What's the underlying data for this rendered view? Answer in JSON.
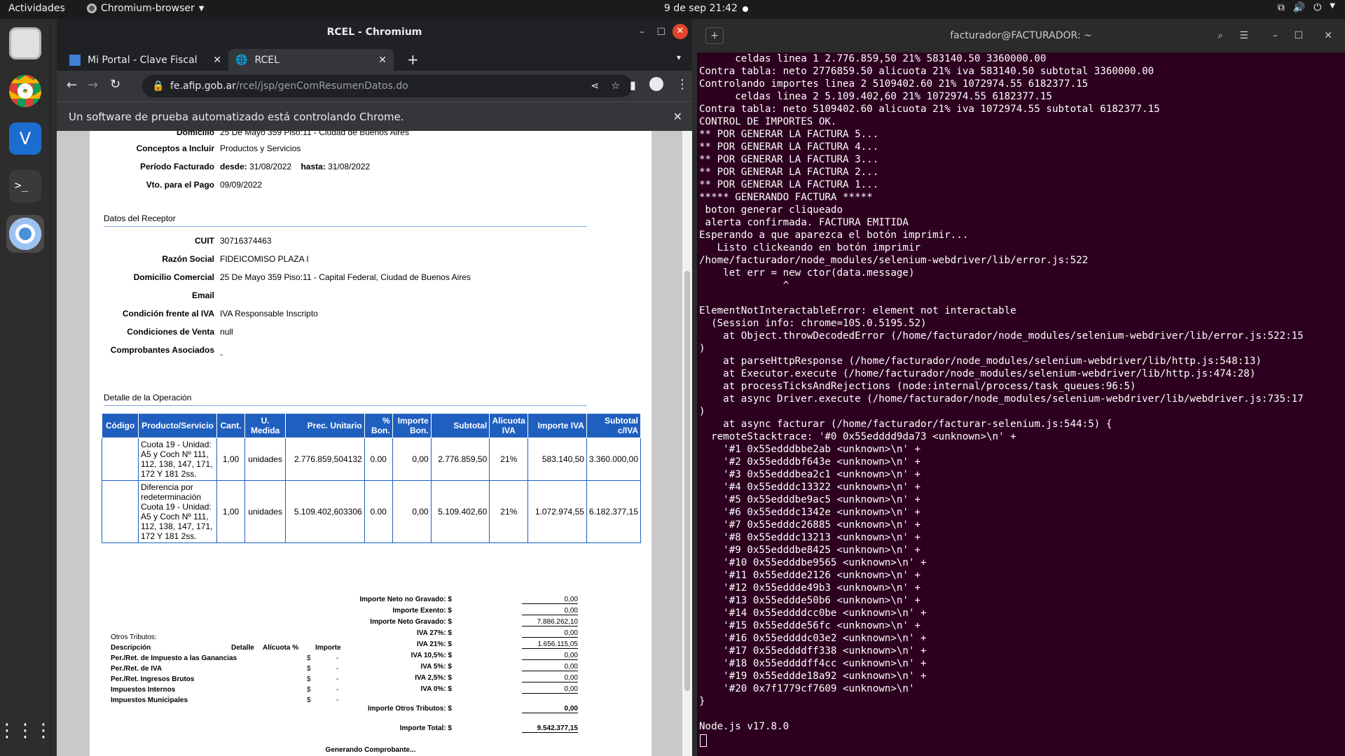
{
  "topbar": {
    "activities": "Actividades",
    "app": "Chromium-browser",
    "clock": "9 de sep  21:42"
  },
  "browser": {
    "window_title": "RCEL - Chromium",
    "tabs": [
      {
        "label": "Mi Portal - Clave Fiscal"
      },
      {
        "label": "RCEL"
      }
    ],
    "url_host": "fe.afip.gob.ar",
    "url_path": "/rcel/jsp/genComResumenDatos.do",
    "infobar": "Un software de prueba automatizado está controlando Chrome."
  },
  "invoice": {
    "top_rows": [
      {
        "label": "Domicilio",
        "value": "25 De Mayo 359 Piso:11 - Ciudad de Buenos Aires"
      },
      {
        "label": "Conceptos a Incluir",
        "value": "Productos y Servicios"
      },
      {
        "label": "Período Facturado",
        "value": ""
      },
      {
        "label": "Vto. para el Pago",
        "value": "09/09/2022"
      }
    ],
    "periodo": {
      "desde_label": "desde:",
      "desde": "31/08/2022",
      "hasta_label": "hasta:",
      "hasta": "31/08/2022"
    },
    "receptor_title": "Datos del Receptor",
    "receptor": [
      {
        "label": "CUIT",
        "value": "30716374463"
      },
      {
        "label": "Razón Social",
        "value": "FIDEICOMISO PLAZA I"
      },
      {
        "label": "Domicilio Comercial",
        "value": "25 De Mayo 359 Piso:11 - Capital Federal, Ciudad de Buenos Aires"
      },
      {
        "label": "Email",
        "value": ""
      },
      {
        "label": "Condición frente al IVA",
        "value": "IVA Responsable Inscripto"
      },
      {
        "label": "Condiciones de Venta",
        "value": "null"
      },
      {
        "label": "Comprobantes Asociados",
        "value": "-"
      }
    ],
    "detalle_title": "Detalle de la Operación",
    "columns": [
      "Código",
      "Producto/Servicio",
      "Cant.",
      "U. Medida",
      "Prec. Unitario",
      "% Bon.",
      "Importe Bon.",
      "Subtotal",
      "Alicuota IVA",
      "Importe IVA",
      "Subtotal c/IVA"
    ],
    "rows": [
      [
        "",
        "Cuota 19 - Unidad: A5 y Coch Nº 111, 112, 138, 147, 171, 172 Y 181 2ss.",
        "1,00",
        "unidades",
        "2.776.859,504132",
        "0.00",
        "0,00",
        "2.776.859,50",
        "21%",
        "583.140,50",
        "3.360.000,00"
      ],
      [
        "",
        "Diferencia por redeterminación Cuota 19 - Unidad: A5 y Coch Nº 111, 112, 138, 147, 171, 172 Y 181 2ss.",
        "1,00",
        "unidades",
        "5.109.402,603306",
        "0.00",
        "0,00",
        "5.109.402,60",
        "21%",
        "1.072.974,55",
        "6.182.377,15"
      ]
    ],
    "totals": [
      {
        "label": "Importe Neto no Gravado: $",
        "value": "0,00"
      },
      {
        "label": "Importe Exento: $",
        "value": "0,00"
      },
      {
        "label": "Importe Neto Gravado: $",
        "value": "7.886.262,10"
      },
      {
        "label": "IVA 27%: $",
        "value": "0,00"
      },
      {
        "label": "IVA 21%: $",
        "value": "1.656.115,05"
      },
      {
        "label": "IVA 10,5%: $",
        "value": "0,00"
      },
      {
        "label": "IVA 5%: $",
        "value": "0,00"
      },
      {
        "label": "IVA 2,5%: $",
        "value": "0,00"
      },
      {
        "label": "IVA 0%: $",
        "value": "0,00"
      }
    ],
    "otros_total": {
      "label": "Importe Otros Tributos: $",
      "value": "0,00"
    },
    "total": {
      "label": "Importe Total: $",
      "value": "9.542.377,15"
    },
    "otros": {
      "title": "Otros Tributos:",
      "headers": [
        "Descripción",
        "Detalle",
        "Alícuota %",
        "Importe"
      ],
      "rows": [
        {
          "desc": "Per./Ret. de Impuesto a las Ganancias",
          "cur": "$",
          "val": "-"
        },
        {
          "desc": "Per./Ret. de IVA",
          "cur": "$",
          "val": "-"
        },
        {
          "desc": "Per./Ret. Ingresos Brutos",
          "cur": "$",
          "val": "-"
        },
        {
          "desc": "Impuestos Internos",
          "cur": "$",
          "val": "-"
        },
        {
          "desc": "Impuestos Municipales",
          "cur": "$",
          "val": "-"
        }
      ]
    },
    "footer": "Generando Comprobante..."
  },
  "terminal": {
    "title": "facturador@FACTURADOR: ~",
    "lines": [
      "      celdas linea 1 2.776.859,50 21% 583140.50 3360000.00",
      "Contra tabla: neto 2776859.50 alicuota 21% iva 583140.50 subtotal 3360000.00",
      "Controlando importes linea 2 5109402.60 21% 1072974.55 6182377.15",
      "      celdas linea 2 5.109.402,60 21% 1072974.55 6182377.15",
      "Contra tabla: neto 5109402.60 alicuota 21% iva 1072974.55 subtotal 6182377.15",
      "CONTROL DE IMPORTES OK.",
      "** POR GENERAR LA FACTURA 5...",
      "** POR GENERAR LA FACTURA 4...",
      "** POR GENERAR LA FACTURA 3...",
      "** POR GENERAR LA FACTURA 2...",
      "** POR GENERAR LA FACTURA 1...",
      "***** GENERANDO FACTURA *****",
      " boton generar cliqueado",
      " alerta confirmada. FACTURA EMITIDA",
      "Esperando a que aparezca el botón imprimir...",
      "   Listo clickeando en botón imprimir",
      "/home/facturador/node_modules/selenium-webdriver/lib/error.js:522",
      "    let err = new ctor(data.message)",
      "              ^",
      "",
      "ElementNotInteractableError: element not interactable",
      "  (Session info: chrome=105.0.5195.52)",
      "    at Object.throwDecodedError (/home/facturador/node_modules/selenium-webdriver/lib/error.js:522:15",
      ")",
      "    at parseHttpResponse (/home/facturador/node_modules/selenium-webdriver/lib/http.js:548:13)",
      "    at Executor.execute (/home/facturador/node_modules/selenium-webdriver/lib/http.js:474:28)",
      "    at processTicksAndRejections (node:internal/process/task_queues:96:5)",
      "    at async Driver.execute (/home/facturador/node_modules/selenium-webdriver/lib/webdriver.js:735:17",
      ")",
      "    at async facturar (/home/facturador/facturar-selenium.js:544:5) {",
      "  remoteStacktrace: '#0 0x55edddd9da73 <unknown>\\n' +",
      "    '#1 0x55edddbbe2ab <unknown>\\n' +",
      "    '#2 0x55edddbf643e <unknown>\\n' +",
      "    '#3 0x55edddbea2c1 <unknown>\\n' +",
      "    '#4 0x55edddc13322 <unknown>\\n' +",
      "    '#5 0x55edddbe9ac5 <unknown>\\n' +",
      "    '#6 0x55edddc1342e <unknown>\\n' +",
      "    '#7 0x55edddc26885 <unknown>\\n' +",
      "    '#8 0x55edddc13213 <unknown>\\n' +",
      "    '#9 0x55edddbe8425 <unknown>\\n' +",
      "    '#10 0x55edddbe9565 <unknown>\\n' +",
      "    '#11 0x55eddde2126 <unknown>\\n' +",
      "    '#12 0x55eddde49b3 <unknown>\\n' +",
      "    '#13 0x55eddde50b6 <unknown>\\n' +",
      "    '#14 0x55eddddcc0be <unknown>\\n' +",
      "    '#15 0x55eddde56fc <unknown>\\n' +",
      "    '#16 0x55eddddc03e2 <unknown>\\n' +",
      "    '#17 0x55eddddff338 <unknown>\\n' +",
      "    '#18 0x55eddddff4cc <unknown>\\n' +",
      "    '#19 0x55eddde18a92 <unknown>\\n' +",
      "    '#20 0x7f1779cf7609 <unknown>\\n'",
      "}",
      "",
      "Node.js v17.8.0"
    ]
  }
}
